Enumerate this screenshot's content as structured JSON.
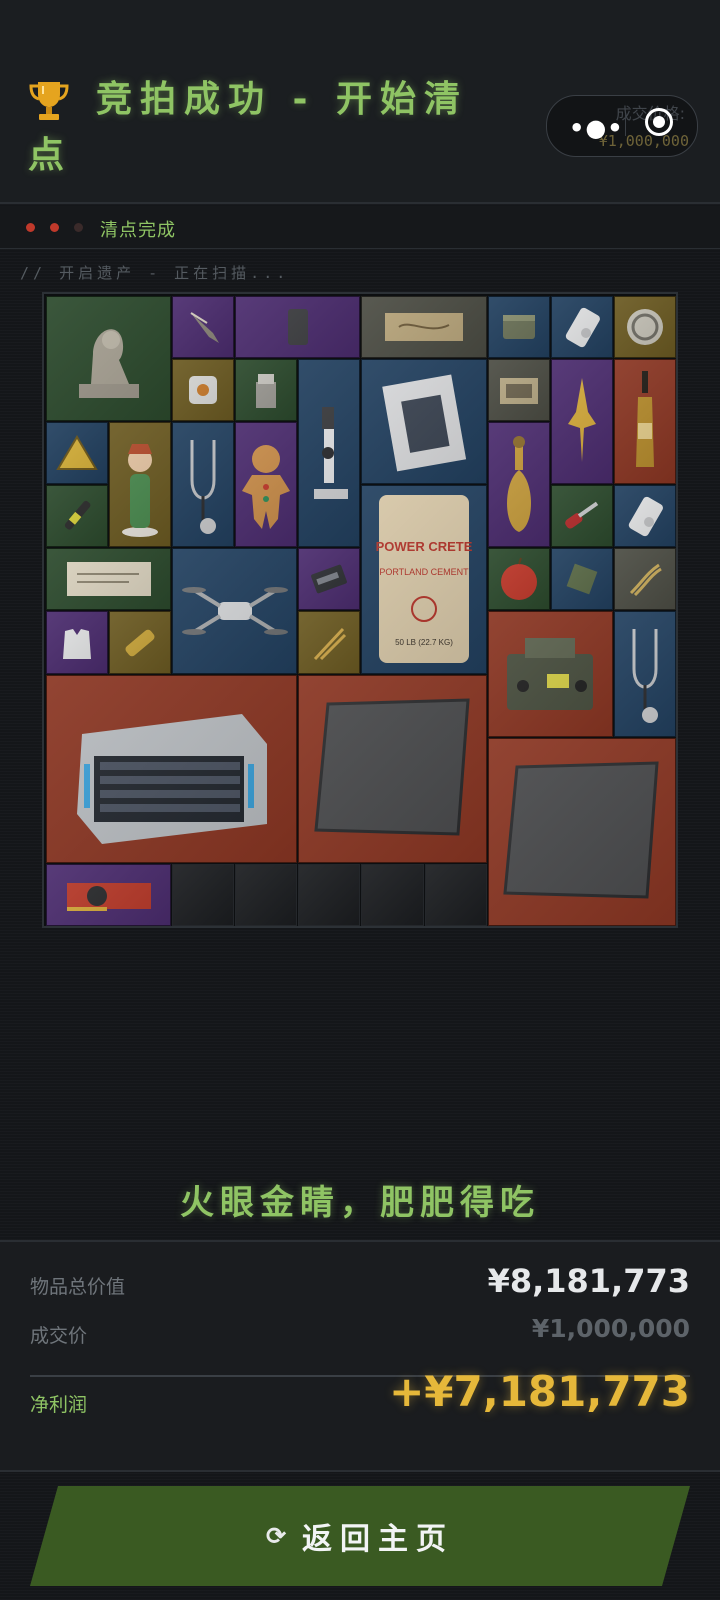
{
  "header": {
    "title": "竞拍成功 - 开始清点",
    "trophy_icon": "trophy-icon",
    "price_label": "成交价格:",
    "price_value": "¥1,000,000",
    "menu_icon": "more-dots-icon",
    "record_icon": "record-icon"
  },
  "status": {
    "text": "清点完成",
    "dot_colors": [
      "#c0392b",
      "#c0392b",
      "#3a2a2a"
    ]
  },
  "scan_text": "// 开启遗产 - 正在扫描...",
  "rarity_colors": {
    "green": "#2c4a2d",
    "purple": "#4b2c6e",
    "blue": "#22405f",
    "gold": "#6b5a22",
    "gray": "#4c4d44",
    "red": "#8a3623"
  },
  "items": [
    {
      "name": "sphinx-statue",
      "icon": "sphinx-icon",
      "rarity": "green"
    },
    {
      "name": "spearhead",
      "icon": "spearhead-icon",
      "rarity": "purple"
    },
    {
      "name": "dark-brick",
      "icon": "brick-icon",
      "rarity": "purple"
    },
    {
      "name": "treasure-map",
      "icon": "map-icon",
      "rarity": "gray"
    },
    {
      "name": "tin-can",
      "icon": "can-icon",
      "rarity": "blue"
    },
    {
      "name": "mp3-player",
      "icon": "mp3-player-icon",
      "rarity": "blue"
    },
    {
      "name": "coin-badge",
      "icon": "coin-icon",
      "rarity": "gold"
    },
    {
      "name": "companion-cube",
      "icon": "cube-icon",
      "rarity": "gold"
    },
    {
      "name": "lighter",
      "icon": "lighter-icon",
      "rarity": "green"
    },
    {
      "name": "microscope",
      "icon": "microscope-icon",
      "rarity": "blue"
    },
    {
      "name": "magazine",
      "icon": "magazine-icon",
      "rarity": "blue"
    },
    {
      "name": "ration-box",
      "icon": "box-icon",
      "rarity": "gray"
    },
    {
      "name": "golden-ornament",
      "icon": "golden-ornament-icon",
      "rarity": "purple"
    },
    {
      "name": "champagne",
      "icon": "bottle-icon",
      "rarity": "red"
    },
    {
      "name": "warning-sign",
      "icon": "warning-sign-icon",
      "rarity": "blue"
    },
    {
      "name": "figurine",
      "icon": "figurine-icon",
      "rarity": "gold"
    },
    {
      "name": "stethoscope",
      "icon": "stethoscope-icon",
      "rarity": "blue"
    },
    {
      "name": "gingerbread-man",
      "icon": "gingerbread-icon",
      "rarity": "purple"
    },
    {
      "name": "cement-bag",
      "icon": "cement-bag-icon",
      "rarity": "blue"
    },
    {
      "name": "hookah",
      "icon": "hookah-icon",
      "rarity": "purple"
    },
    {
      "name": "pen-tool",
      "icon": "pen-icon",
      "rarity": "green"
    },
    {
      "name": "screwdriver",
      "icon": "screwdriver-icon",
      "rarity": "green"
    },
    {
      "name": "mp3-player-2",
      "icon": "mp3-player-icon",
      "rarity": "blue"
    },
    {
      "name": "old-document",
      "icon": "document-icon",
      "rarity": "green"
    },
    {
      "name": "drone",
      "icon": "drone-icon",
      "rarity": "blue"
    },
    {
      "name": "ssd-drive",
      "icon": "ssd-icon",
      "rarity": "purple"
    },
    {
      "name": "apple",
      "icon": "apple-icon",
      "rarity": "green"
    },
    {
      "name": "ration-pack",
      "icon": "pack-icon",
      "rarity": "blue"
    },
    {
      "name": "rope",
      "icon": "rope-icon",
      "rarity": "gray"
    },
    {
      "name": "vest",
      "icon": "vest-icon",
      "rarity": "purple"
    },
    {
      "name": "scroll",
      "icon": "scroll-icon",
      "rarity": "gold"
    },
    {
      "name": "tongs",
      "icon": "tongs-icon",
      "rarity": "gold"
    },
    {
      "name": "radio",
      "icon": "radio-icon",
      "rarity": "red"
    },
    {
      "name": "stethoscope-2",
      "icon": "stethoscope-icon",
      "rarity": "blue"
    },
    {
      "name": "server-case",
      "icon": "server-icon",
      "rarity": "red"
    },
    {
      "name": "metal-plate",
      "icon": "plate-icon",
      "rarity": "red"
    },
    {
      "name": "metal-plate-2",
      "icon": "plate-icon",
      "rarity": "red"
    },
    {
      "name": "graphics-card",
      "icon": "graphics-card-icon",
      "rarity": "purple"
    }
  ],
  "slogan": "火眼金睛，肥肥得吃",
  "summary": {
    "total_label": "物品总价值",
    "total_value": "¥8,181,773",
    "deal_label": "成交价",
    "deal_value": "¥1,000,000",
    "profit_label": "净利润",
    "profit_value": "+¥7,181,773"
  },
  "back_button": {
    "label": "返回主页",
    "icon": "refresh-icon"
  }
}
